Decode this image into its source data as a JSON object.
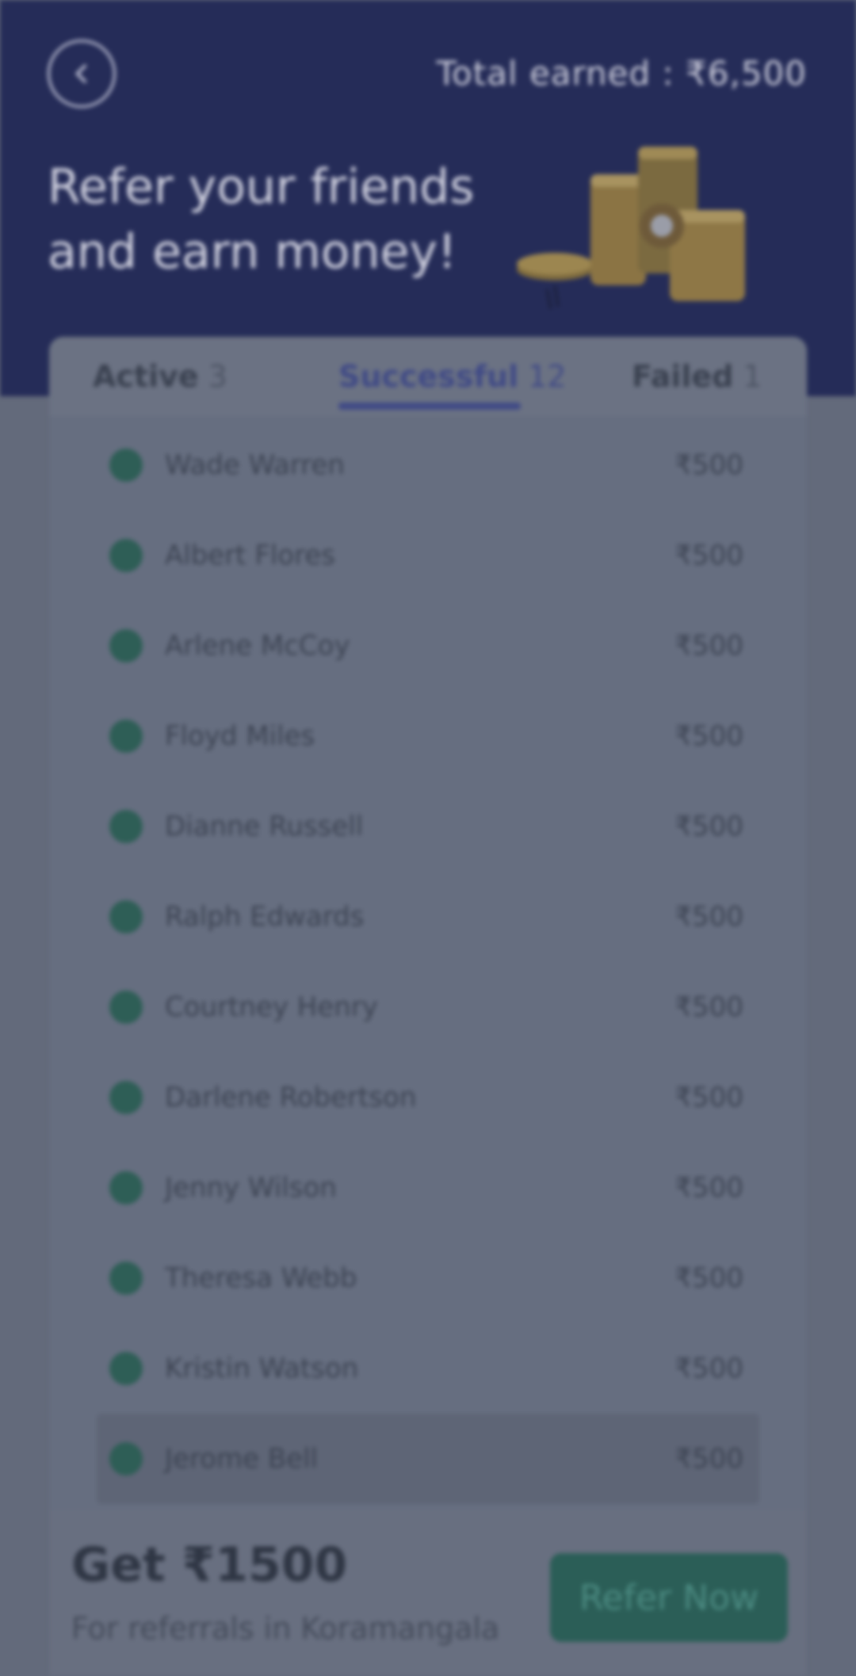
{
  "header": {
    "back_icon": "chevron-left-icon",
    "total_earned": "Total earned : ₹6,500",
    "headline": "Refer your friends and earn money!",
    "art_icon": "coins-icon"
  },
  "tabs": [
    {
      "label": "Active",
      "count": "3"
    },
    {
      "label": "Successful",
      "count": "12"
    },
    {
      "label": "Failed",
      "count": "1"
    }
  ],
  "referrals": [
    {
      "name": "Wade Warren",
      "amount": "₹500"
    },
    {
      "name": "Albert Flores",
      "amount": "₹500"
    },
    {
      "name": "Arlene McCoy",
      "amount": "₹500"
    },
    {
      "name": "Floyd Miles",
      "amount": "₹500"
    },
    {
      "name": "Dianne Russell",
      "amount": "₹500"
    },
    {
      "name": "Ralph Edwards",
      "amount": "₹500"
    },
    {
      "name": "Courtney Henry",
      "amount": "₹500"
    },
    {
      "name": "Darlene Robertson",
      "amount": "₹500"
    },
    {
      "name": "Jenny Wilson",
      "amount": "₹500"
    },
    {
      "name": "Theresa Webb",
      "amount": "₹500"
    },
    {
      "name": "Kristin Watson",
      "amount": "₹500"
    },
    {
      "name": "Jerome Bell",
      "amount": "₹500"
    }
  ],
  "footer": {
    "title": "Get ₹1500",
    "subtitle": "For referrals in Koramangala",
    "button": "Refer Now"
  },
  "colors": {
    "header_bg": "#252c58",
    "accent": "#404a86",
    "success_dot": "#2e5e56",
    "button_bg": "#2b5e57"
  }
}
